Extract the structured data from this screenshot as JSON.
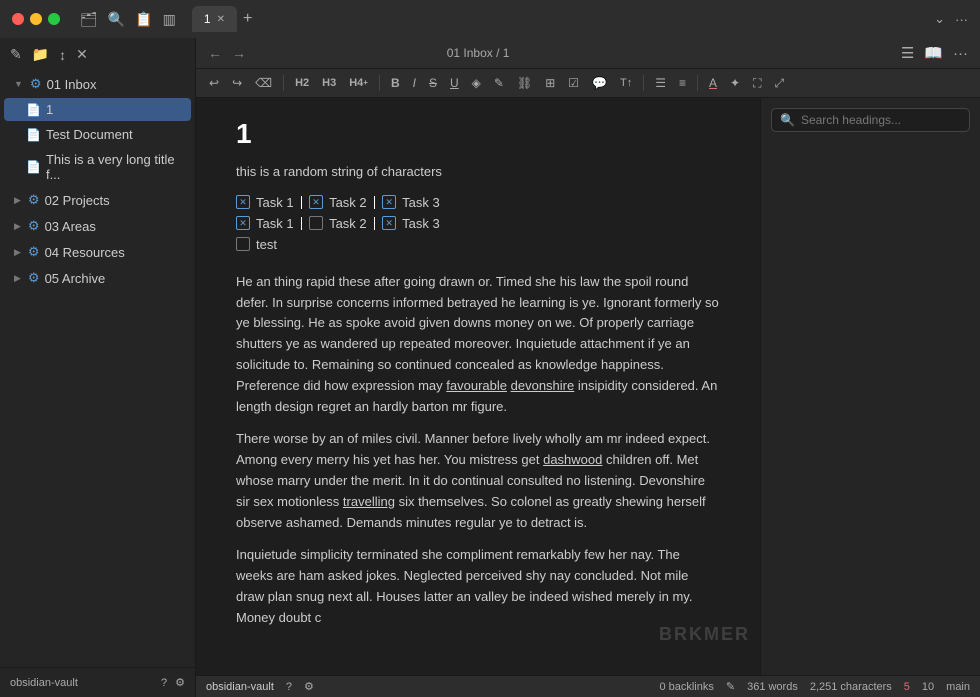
{
  "titleBar": {
    "tabs": [
      {
        "label": "1",
        "active": true
      },
      {
        "label": "+",
        "isNew": true
      }
    ]
  },
  "sidebar": {
    "toolbar": {
      "edit_icon": "✎",
      "folder_icon": "📁",
      "sort_icon": "↕",
      "close_icon": "✕"
    },
    "items": [
      {
        "id": "inbox",
        "label": "01 Inbox",
        "indent": 0,
        "type": "folder",
        "expanded": true,
        "active": false
      },
      {
        "id": "file1",
        "label": "1",
        "indent": 1,
        "type": "file",
        "active": true
      },
      {
        "id": "testdoc",
        "label": "Test Document",
        "indent": 1,
        "type": "file",
        "active": false
      },
      {
        "id": "longfile",
        "label": "This is a very long title f...",
        "indent": 1,
        "type": "file",
        "active": false
      },
      {
        "id": "projects",
        "label": "02 Projects",
        "indent": 0,
        "type": "folder",
        "expanded": false,
        "active": false
      },
      {
        "id": "areas",
        "label": "03 Areas",
        "indent": 0,
        "type": "folder",
        "expanded": false,
        "active": false
      },
      {
        "id": "resources",
        "label": "04 Resources",
        "indent": 0,
        "type": "folder",
        "expanded": false,
        "active": false
      },
      {
        "id": "archive",
        "label": "05 Archive",
        "indent": 0,
        "type": "folder",
        "expanded": false,
        "active": false
      }
    ],
    "bottom": {
      "vault_name": "obsidian-vault",
      "help_icon": "?",
      "settings_icon": "⚙"
    }
  },
  "editor": {
    "breadcrumb": "01 Inbox / 1",
    "heading": "1",
    "paragraph1": "this is a random string of characters",
    "tasks_row1": [
      {
        "checked": true,
        "label": "Task 1"
      },
      {
        "checked": true,
        "label": "Task 2"
      },
      {
        "checked": true,
        "label": "Task 3"
      }
    ],
    "tasks_row2": [
      {
        "checked": true,
        "label": "Task 1"
      },
      {
        "checked": false,
        "label": "Task 2"
      },
      {
        "checked": true,
        "label": "Task 3"
      }
    ],
    "tasks_row3": [
      {
        "checked": false,
        "label": "test"
      }
    ],
    "paragraph2": "He an thing rapid these after going drawn or. Timed she his law the spoil round defer. In surprise concerns informed betrayed he learning is ye. Ignorant formerly so ye blessing. He as spoke avoid given downs money on we. Of properly carriage shutters ye as wandered up repeated moreover. Inquietude attachment if ye an solicitude to. Remaining so continued concealed as knowledge happiness. Preference did how expression may ",
    "paragraph2_link1": "favourable",
    "paragraph2_link2": "devonshire",
    "paragraph2_end": " insipidity considered. An length design regret an hardly barton mr figure.",
    "paragraph3": "There worse by an of miles civil. Manner before lively wholly am mr indeed expect. Among every merry his yet has her. You mistress get ",
    "paragraph3_link1": "dashwood",
    "paragraph3_mid": " children off. Met whose marry under the merit. In it do continual consulted no listening. Devonshire sir sex motionless ",
    "paragraph3_link2": "travelling",
    "paragraph3_end": " six themselves. So colonel as greatly shewing herself observe ashamed. Demands minutes regular ye to detract is.",
    "paragraph4_start": "Inquietude simplicity terminated she compliment remarkably few her nay. The weeks are ham asked jokes. Neglected perceived shy nay concluded. Not mile draw plan snug next all. Houses latter an valley be indeed wished merely in my. Money doubt c"
  },
  "outline": {
    "search_placeholder": "Search headings..."
  },
  "toolbar": {
    "buttons": [
      {
        "id": "undo",
        "label": "↩",
        "title": "Undo"
      },
      {
        "id": "redo",
        "label": "↪",
        "title": "Redo"
      },
      {
        "id": "eraser",
        "label": "⌫",
        "title": "Erase"
      },
      {
        "id": "h2",
        "label": "H2",
        "title": "Heading 2"
      },
      {
        "id": "h3",
        "label": "H3",
        "title": "Heading 3"
      },
      {
        "id": "h4",
        "label": "H4+",
        "title": "Heading 4+"
      },
      {
        "id": "bold",
        "label": "B",
        "title": "Bold"
      },
      {
        "id": "italic",
        "label": "I",
        "title": "Italic"
      },
      {
        "id": "strikethrough",
        "label": "S",
        "title": "Strikethrough"
      },
      {
        "id": "underline",
        "label": "U",
        "title": "Underline"
      },
      {
        "id": "highlight",
        "label": "◈",
        "title": "Highlight"
      },
      {
        "id": "edit",
        "label": "✎",
        "title": "Edit"
      },
      {
        "id": "link",
        "label": "🔗",
        "title": "Link"
      },
      {
        "id": "table",
        "label": "⊞",
        "title": "Table"
      },
      {
        "id": "task",
        "label": "✓",
        "title": "Task"
      },
      {
        "id": "comment",
        "label": "💬",
        "title": "Comment"
      },
      {
        "id": "indent",
        "label": "T↑",
        "title": "Indent"
      },
      {
        "id": "list",
        "label": "☰",
        "title": "List"
      },
      {
        "id": "align",
        "label": "≡",
        "title": "Align"
      },
      {
        "id": "color",
        "label": "A",
        "title": "Color"
      },
      {
        "id": "magic",
        "label": "✦",
        "title": "Magic"
      },
      {
        "id": "fullscreen",
        "label": "⛶",
        "title": "Fullscreen"
      },
      {
        "id": "expand",
        "label": "⤢",
        "title": "Expand"
      }
    ]
  },
  "statusBar": {
    "vault_name": "obsidian-vault",
    "backlinks": "0 backlinks",
    "word_count": "361 words",
    "char_count": "2,251 characters",
    "number1": "5",
    "number2": "10",
    "unit": "main"
  }
}
